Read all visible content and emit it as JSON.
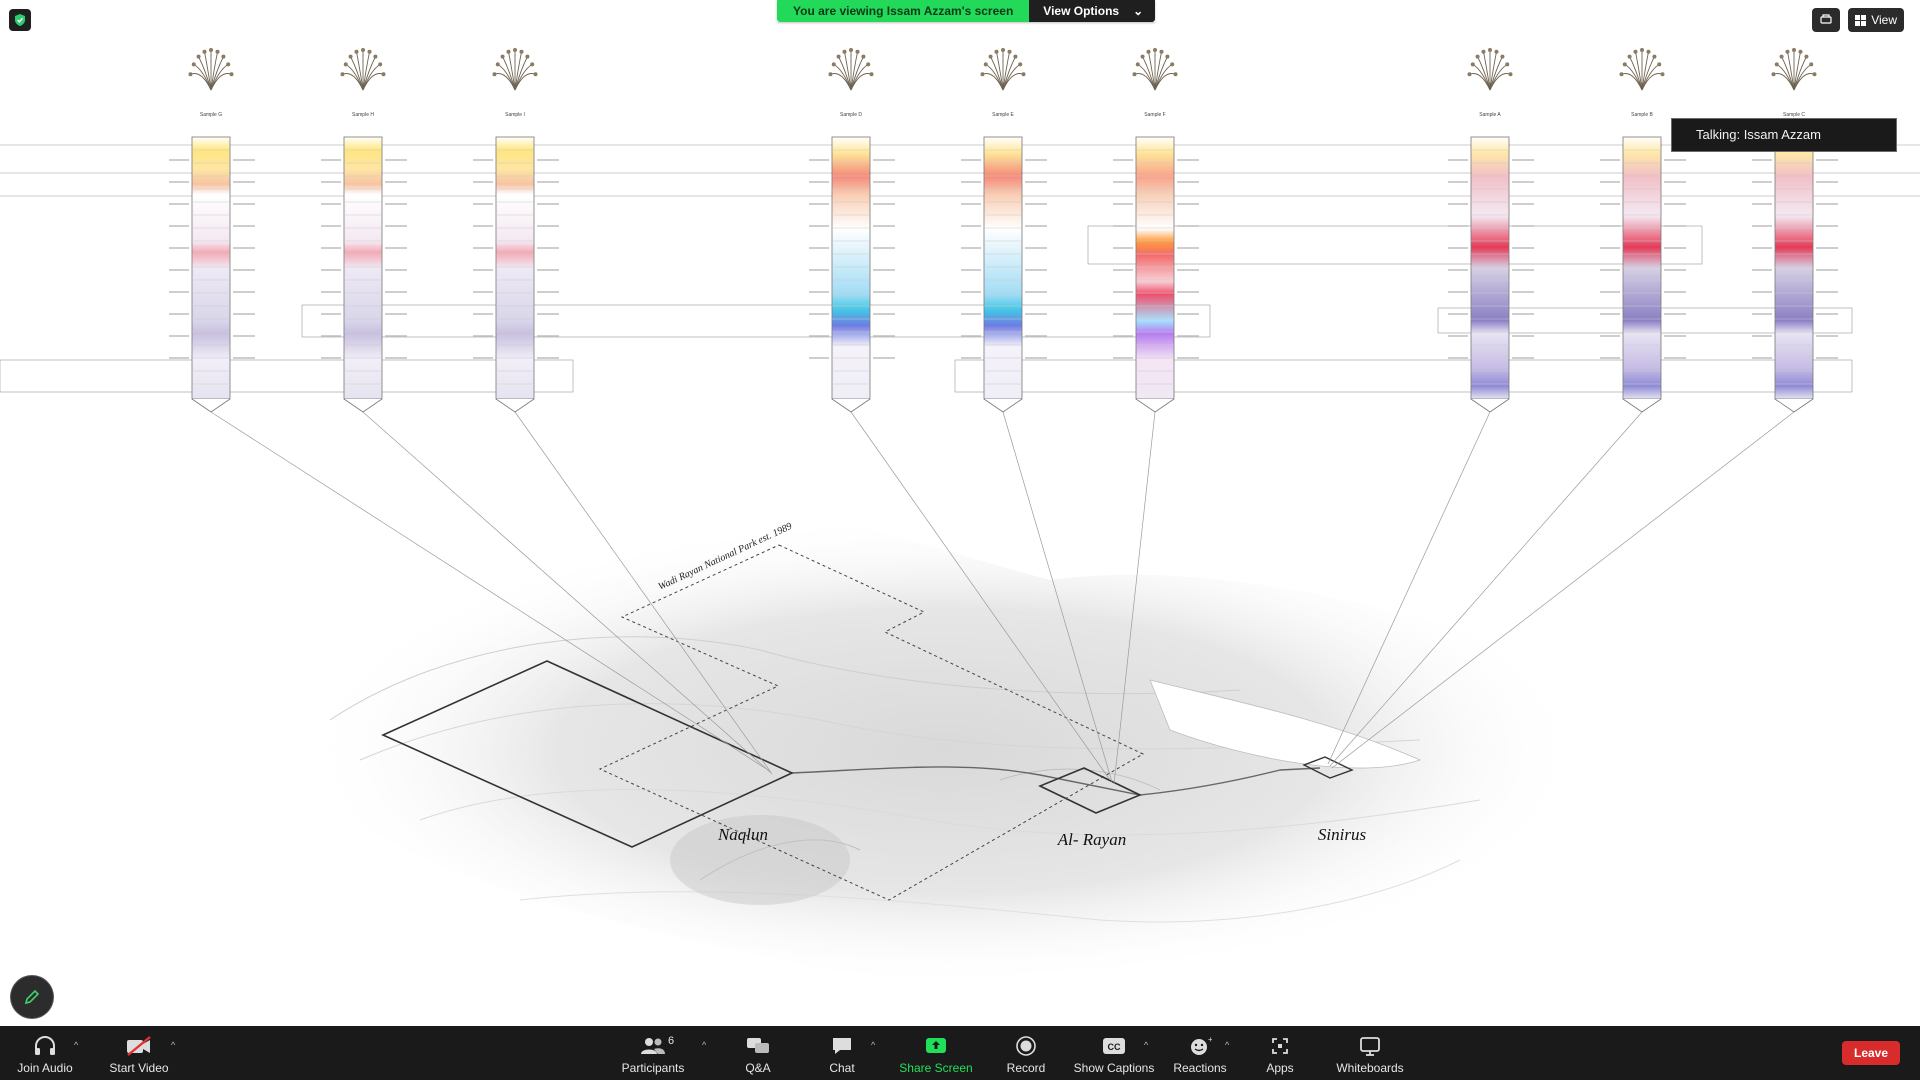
{
  "share_banner": {
    "message": "You are viewing Issam Azzam's screen",
    "view_options_label": "View Options"
  },
  "top_right": {
    "view_label": "View"
  },
  "talking_indicator": {
    "text": "Talking: Issam Azzam"
  },
  "map": {
    "park_label": "Wadi Rayan National Park est. 1989",
    "sites": [
      "Naqlun",
      "Al- Rayan",
      "Sinirus"
    ],
    "samples": [
      "Sample G",
      "Sample H",
      "Sample I",
      "Sample D",
      "Sample E",
      "Sample F",
      "Sample A",
      "Sample B",
      "Sample C"
    ]
  },
  "toolbar": {
    "join_audio": "Join Audio",
    "start_video": "Start Video",
    "participants": "Participants",
    "participants_count": "6",
    "qa": "Q&A",
    "chat": "Chat",
    "share_screen": "Share Screen",
    "record": "Record",
    "show_captions": "Show Captions",
    "reactions": "Reactions",
    "apps": "Apps",
    "whiteboards": "Whiteboards",
    "leave": "Leave"
  },
  "colors": {
    "banner_green": "#23d959",
    "leave_red": "#d82b2b",
    "toolbar_bg": "#1a1a1a",
    "share_green": "#20e05a"
  },
  "icons": [
    "shield-icon",
    "view-icon",
    "headphones-icon",
    "video-off-icon",
    "participants-icon",
    "qa-icon",
    "chat-icon",
    "share-screen-icon",
    "record-icon",
    "captions-icon",
    "reactions-icon",
    "apps-icon",
    "whiteboards-icon",
    "pencil-icon"
  ]
}
